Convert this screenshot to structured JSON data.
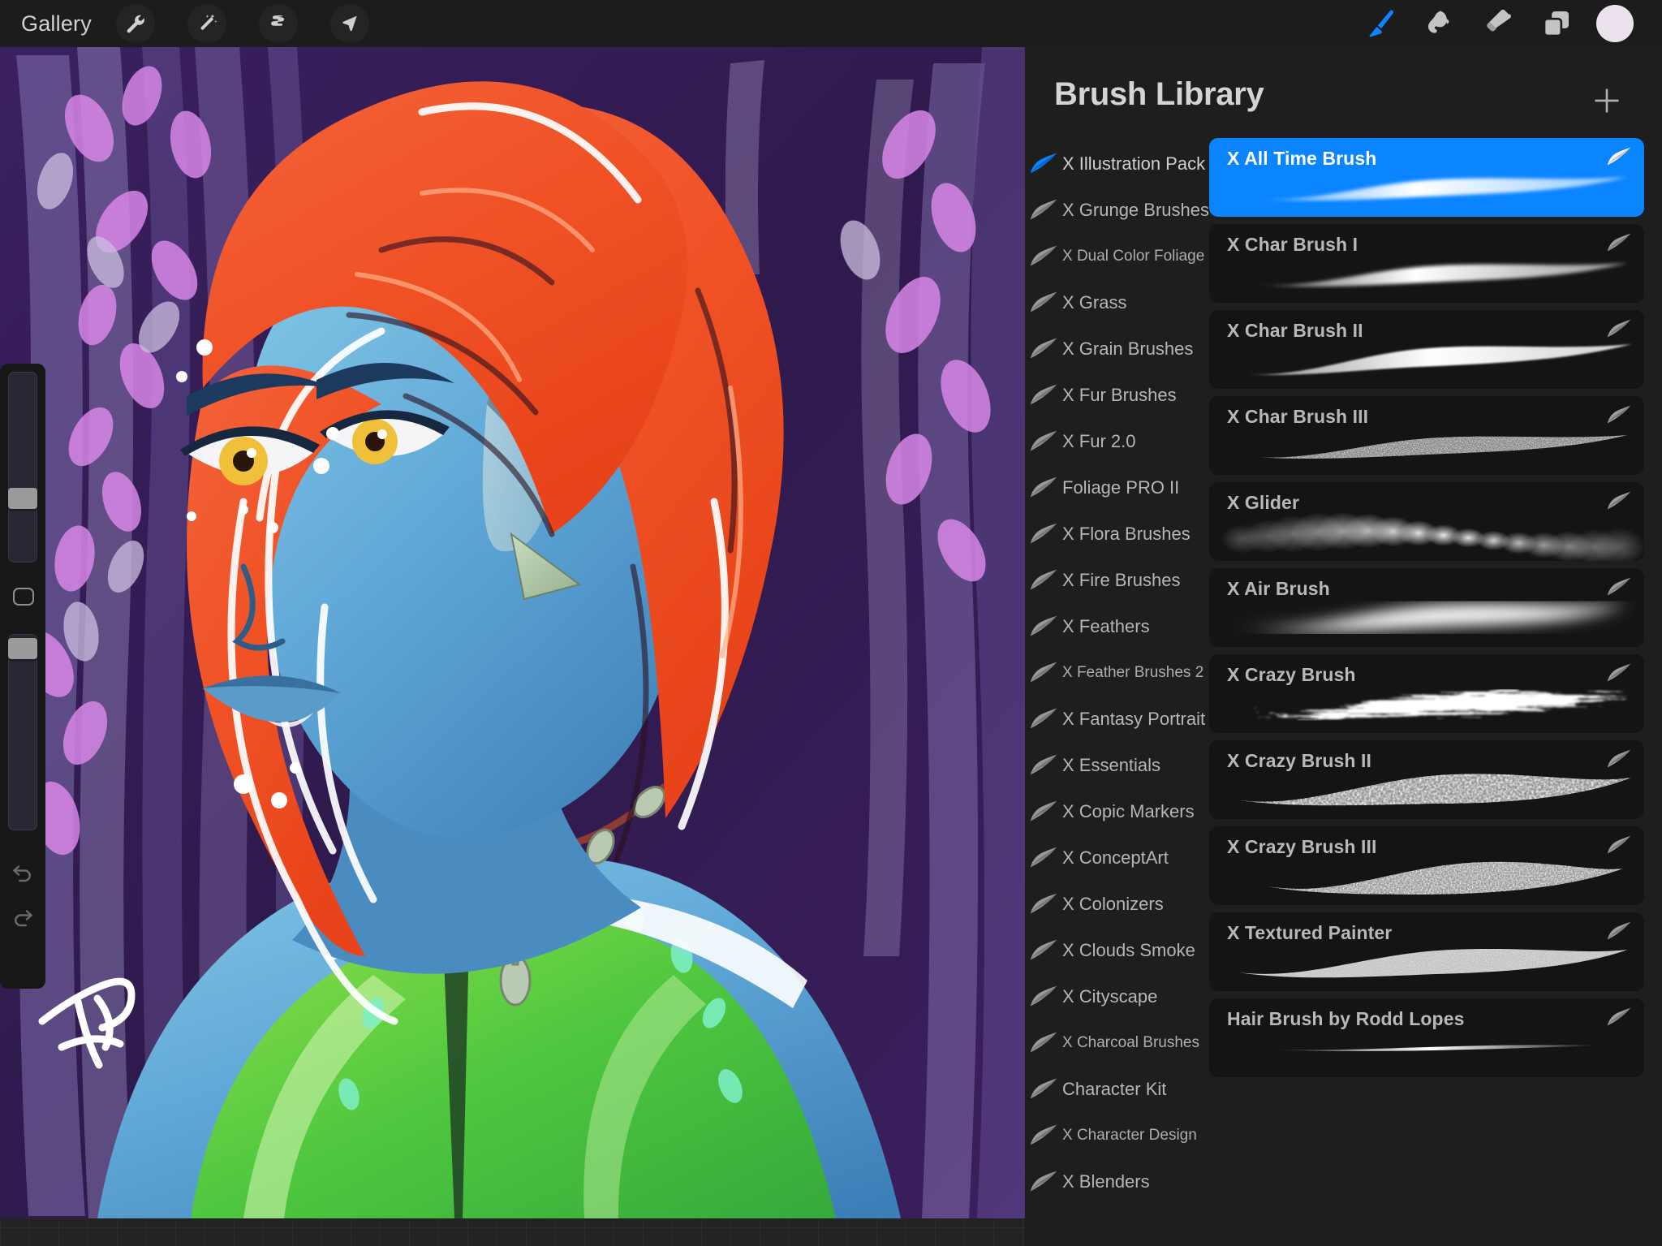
{
  "app": {
    "name": "Procreate",
    "accent": "#0a84ff",
    "panel_bg": "#1e1e1e",
    "canvas_bg": "#2b1446"
  },
  "topbar": {
    "gallery_label": "Gallery",
    "left_tools": [
      {
        "name": "actions-wrench-icon",
        "label": "Actions"
      },
      {
        "name": "adjustments-wand-icon",
        "label": "Adjustments"
      },
      {
        "name": "selection-s-icon",
        "label": "Selection"
      },
      {
        "name": "transform-arrow-icon",
        "label": "Transform"
      }
    ],
    "right_tools": [
      {
        "name": "paint-brush-icon",
        "label": "Paint",
        "active": true
      },
      {
        "name": "smudge-icon",
        "label": "Smudge",
        "active": false
      },
      {
        "name": "eraser-icon",
        "label": "Erase",
        "active": false
      },
      {
        "name": "layers-icon",
        "label": "Layers",
        "active": false
      },
      {
        "name": "color-swatch",
        "label": "Color",
        "color": "#ece2ee"
      }
    ]
  },
  "sidebar": {
    "brush_size": {
      "label": "Brush size",
      "handle_pct": 68
    },
    "modify_button": {
      "label": "Modify"
    },
    "brush_opacity": {
      "label": "Brush opacity",
      "handle_pct": 2
    },
    "undo": {
      "label": "Undo"
    },
    "redo": {
      "label": "Redo"
    }
  },
  "panel": {
    "title": "Brush Library",
    "add_label": "+",
    "sets": [
      {
        "label": "X Illustration Pack",
        "selected": true,
        "small": false
      },
      {
        "label": "X Grunge Brushes",
        "selected": false,
        "small": false
      },
      {
        "label": "X Dual Color Foliage",
        "selected": false,
        "small": true
      },
      {
        "label": "X Grass",
        "selected": false,
        "small": false
      },
      {
        "label": "X Grain Brushes",
        "selected": false,
        "small": false
      },
      {
        "label": "X Fur Brushes",
        "selected": false,
        "small": false
      },
      {
        "label": "X Fur 2.0",
        "selected": false,
        "small": false
      },
      {
        "label": "Foliage PRO II",
        "selected": false,
        "small": false
      },
      {
        "label": "X Flora Brushes",
        "selected": false,
        "small": false
      },
      {
        "label": "X Fire Brushes",
        "selected": false,
        "small": false
      },
      {
        "label": "X Feathers",
        "selected": false,
        "small": false
      },
      {
        "label": "X Feather Brushes 2",
        "selected": false,
        "small": true
      },
      {
        "label": "X Fantasy Portrait",
        "selected": false,
        "small": false
      },
      {
        "label": "X Essentials",
        "selected": false,
        "small": false
      },
      {
        "label": "X Copic Markers",
        "selected": false,
        "small": false
      },
      {
        "label": "X ConceptArt",
        "selected": false,
        "small": false
      },
      {
        "label": "X Colonizers",
        "selected": false,
        "small": false
      },
      {
        "label": "X Clouds Smoke",
        "selected": false,
        "small": false
      },
      {
        "label": "X Cityscape",
        "selected": false,
        "small": false
      },
      {
        "label": "X Charcoal Brushes",
        "selected": false,
        "small": true
      },
      {
        "label": "Character Kit",
        "selected": false,
        "small": false
      },
      {
        "label": "X Character Design",
        "selected": false,
        "small": true
      },
      {
        "label": "X Blenders",
        "selected": false,
        "small": false
      }
    ],
    "brushes": [
      {
        "label": "X All Time Brush",
        "selected": true,
        "stroke": "smooth-taper"
      },
      {
        "label": "X Char Brush I",
        "selected": false,
        "stroke": "smooth-taper"
      },
      {
        "label": "X Char Brush II",
        "selected": false,
        "stroke": "hard-taper"
      },
      {
        "label": "X Char Brush III",
        "selected": false,
        "stroke": "speckled"
      },
      {
        "label": "X Glider",
        "selected": false,
        "stroke": "blobby-glow"
      },
      {
        "label": "X Air Brush",
        "selected": false,
        "stroke": "soft-blur"
      },
      {
        "label": "X Crazy Brush",
        "selected": false,
        "stroke": "streaky"
      },
      {
        "label": "X Crazy Brush II",
        "selected": false,
        "stroke": "grainy-heavy"
      },
      {
        "label": "X Crazy Brush III",
        "selected": false,
        "stroke": "grainy-diamond"
      },
      {
        "label": "X Textured Painter",
        "selected": false,
        "stroke": "textured"
      },
      {
        "label": "Hair Brush by Rodd Lopes",
        "selected": false,
        "stroke": "thin-line"
      }
    ]
  },
  "artwork": {
    "title": "Blue-skinned elf character portrait",
    "signature": "artist-signature",
    "palette": {
      "bg_purple_dark": "#2f1a4d",
      "bg_purple": "#5a3a80",
      "leaf_pink": "#d887e8",
      "hair_orange": "#f25a2d",
      "skin_blue": "#5fa8d8",
      "eye_gold": "#f0c03a",
      "top_green": "#56cc4a",
      "horn_sage": "#aec4a8"
    }
  }
}
